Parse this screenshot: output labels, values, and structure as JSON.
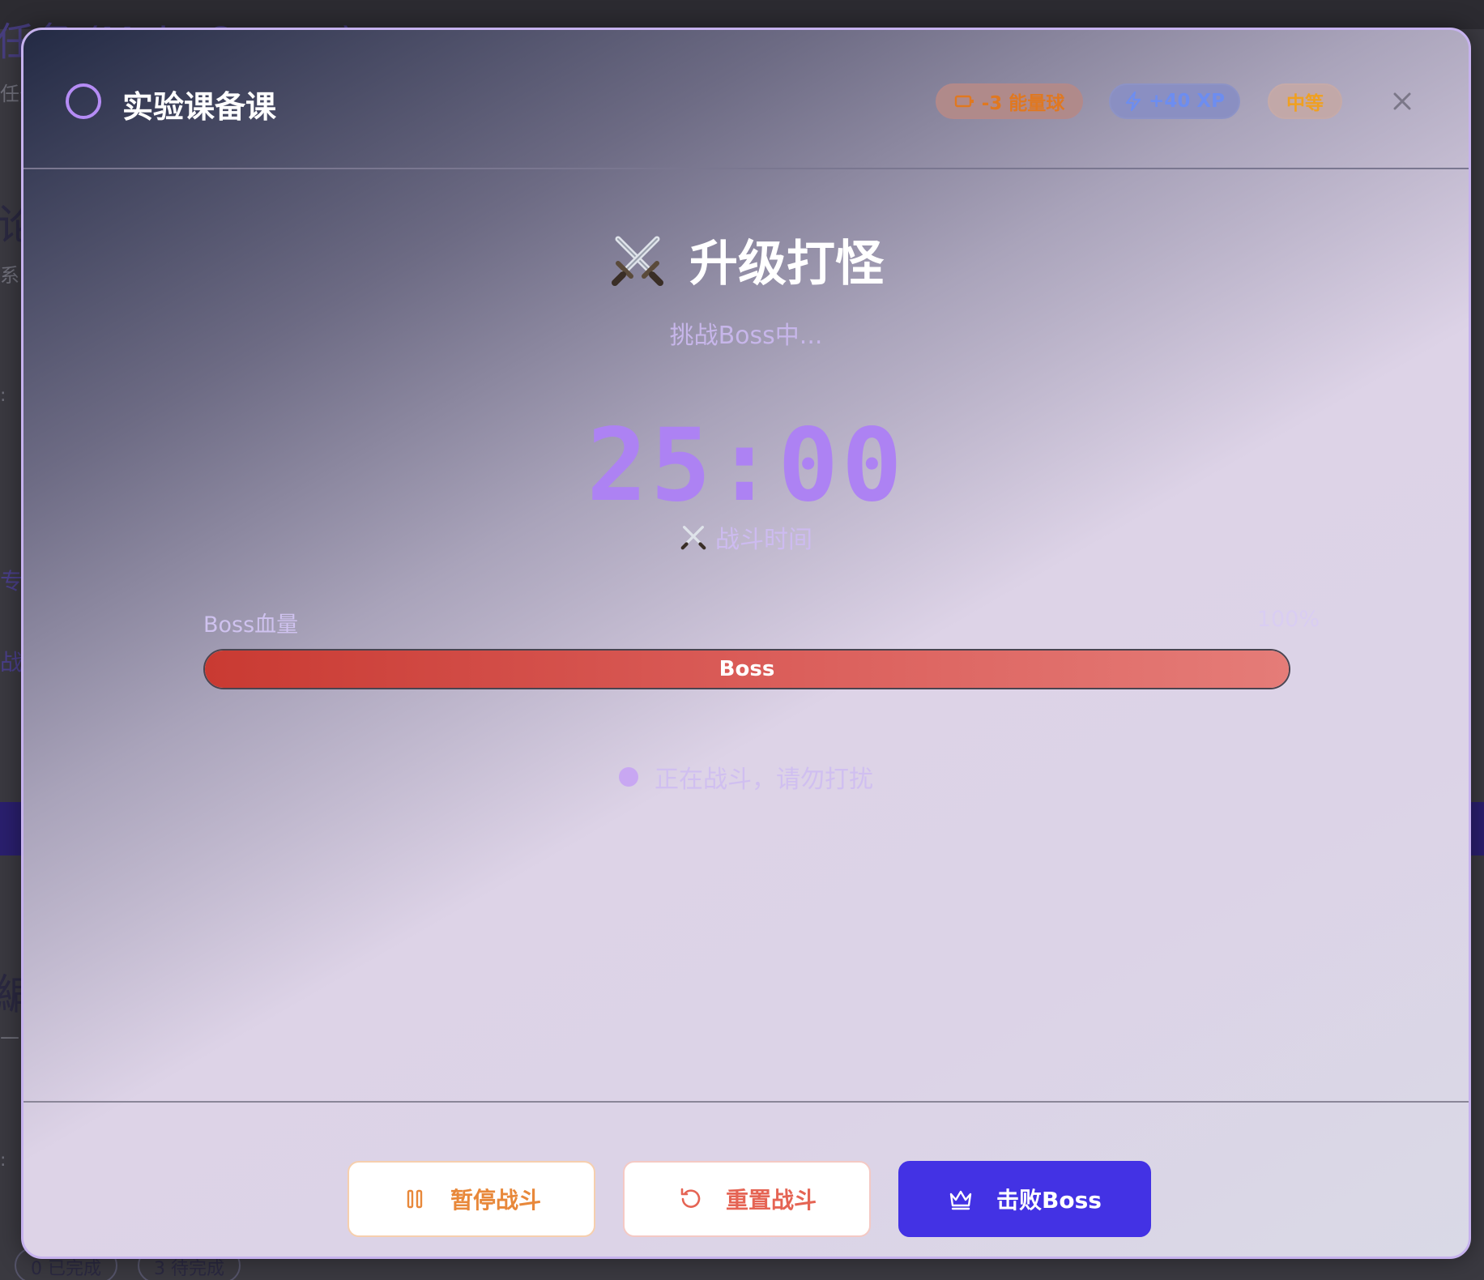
{
  "background": {
    "title": "任务 (Main Quests)",
    "sub1": "任务",
    "big1": "论",
    "sub2": "系",
    "colon1": ":",
    "zh1": "专",
    "zh2": "战",
    "big2": "編",
    "sub3": "—",
    "colon2": ":",
    "chip_done": "0 已完成",
    "chip_pending": "3 待完成"
  },
  "modal": {
    "quest_title": "实验课备课",
    "badges": {
      "energy": "-3 能量球",
      "xp": "+40 XP",
      "difficulty": "中等"
    },
    "main_title": "升级打怪",
    "subtitle": "挑战Boss中...",
    "timer": "25:00",
    "timer_label": "战斗时间",
    "hp": {
      "label": "Boss血量",
      "percent_text": "100%",
      "percent": 100,
      "bar_text": "Boss"
    },
    "status_text": "正在战斗，请勿打扰",
    "buttons": {
      "pause": "暂停战斗",
      "reset": "重置战斗",
      "defeat": "击败Boss"
    }
  },
  "colors": {
    "accent": "#ad82f3",
    "primary_button": "#4332e4",
    "hp_fill_start": "#c93a32",
    "hp_fill_end": "#e57c78",
    "energy": "#e07820",
    "xp": "#6d8df0",
    "difficulty": "#f0a020"
  },
  "icons": {
    "status": "circle-outline-icon",
    "energy": "battery-icon",
    "xp": "lightning-icon",
    "close": "close-icon",
    "title": "crossed-swords-icon",
    "pause": "pause-icon",
    "reset": "rotate-ccw-icon",
    "defeat": "crown-icon"
  }
}
